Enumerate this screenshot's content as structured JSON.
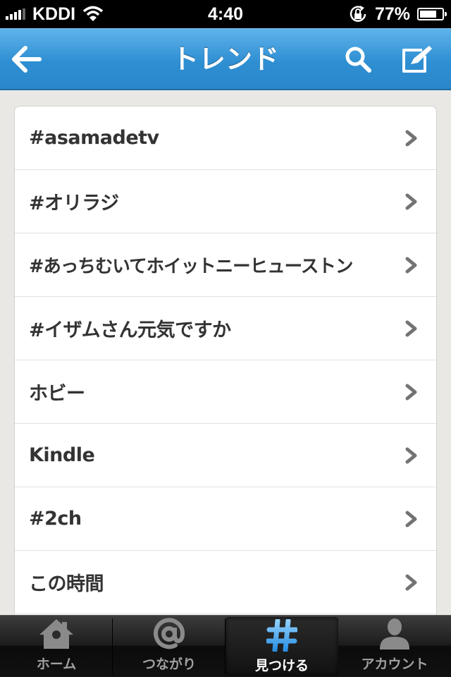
{
  "status_bar": {
    "carrier": "KDDI",
    "time": "4:40",
    "battery_text": "77%",
    "battery_level": 0.77,
    "signal_icon": "signal-bars-icon",
    "wifi_icon": "wifi-icon",
    "rotation_lock_icon": "rotation-lock-icon"
  },
  "nav": {
    "title": "トレンド",
    "back_icon": "back-arrow-icon",
    "search_icon": "search-icon",
    "compose_icon": "compose-icon",
    "color": "#3a99dc"
  },
  "trends": [
    {
      "label": "#asamadetv"
    },
    {
      "label": "#オリラジ"
    },
    {
      "label": "#あっちむいてホイットニーヒューストン"
    },
    {
      "label": "#イザムさん元気ですか"
    },
    {
      "label": "ホビー"
    },
    {
      "label": "Kindle"
    },
    {
      "label": "#2ch"
    },
    {
      "label": "この時間"
    }
  ],
  "tabs": [
    {
      "label": "ホーム",
      "icon": "home-icon",
      "active": false
    },
    {
      "label": "つながり",
      "icon": "at-sign-icon",
      "active": false
    },
    {
      "label": "見つける",
      "icon": "hashtag-icon",
      "active": true
    },
    {
      "label": "アカウント",
      "icon": "person-icon",
      "active": false
    }
  ]
}
